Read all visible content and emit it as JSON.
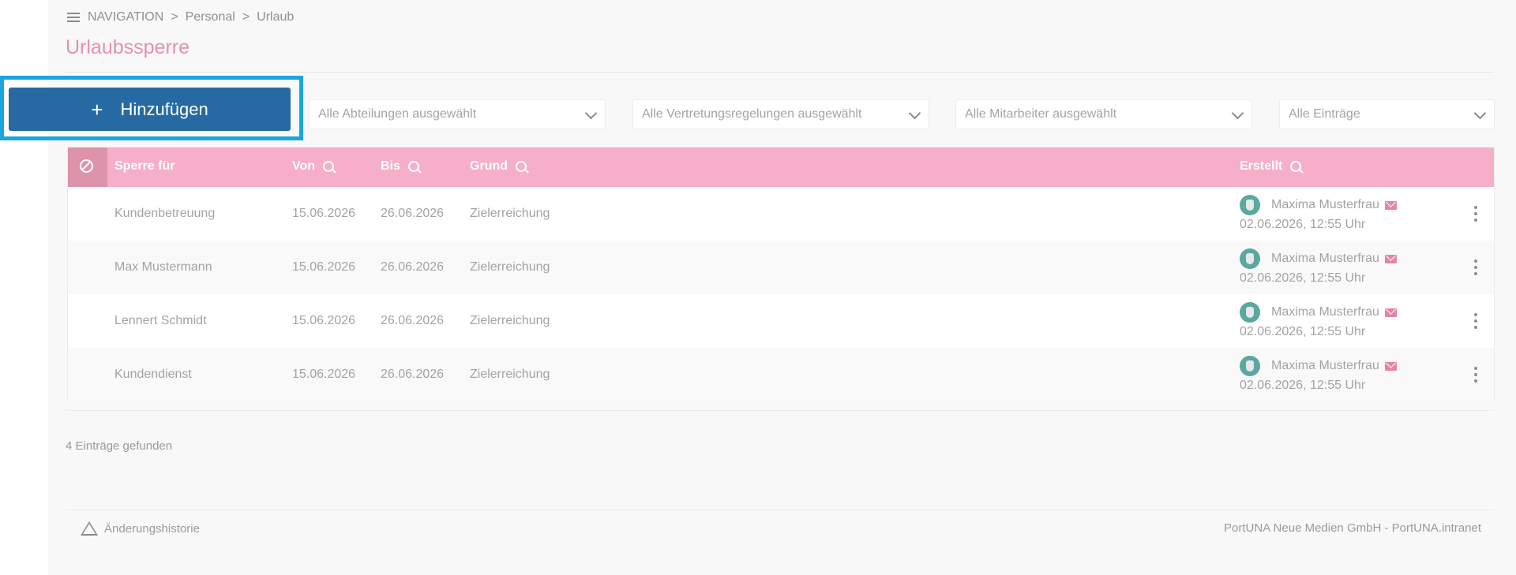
{
  "breadcrumb": {
    "nav": "NAVIGATION",
    "sep": ">",
    "level1": "Personal",
    "level2": "Urlaub"
  },
  "page": {
    "title": "Urlaubssperre"
  },
  "toolbar": {
    "add_plus": "+",
    "add_label": "Hinzufügen"
  },
  "filters": {
    "departments": "Alle Abteilungen ausgewählt",
    "deputies": "Alle Vertretungsregelungen ausgewählt",
    "employees": "Alle Mitarbeiter ausgewählt",
    "entries": "Alle Einträge"
  },
  "table": {
    "headers": {
      "sperre_fuer": "Sperre für",
      "von": "Von",
      "bis": "Bis",
      "grund": "Grund",
      "erstellt": "Erstellt"
    },
    "rows": [
      {
        "sperre_fuer": "Kundenbetreuung",
        "von": "15.06.2026",
        "bis": "26.06.2026",
        "grund": "Zielerreichung",
        "creator": "Maxima Musterfrau",
        "created": "02.06.2026, 12:55 Uhr"
      },
      {
        "sperre_fuer": "Max Mustermann",
        "von": "15.06.2026",
        "bis": "26.06.2026",
        "grund": "Zielerreichung",
        "creator": "Maxima Musterfrau",
        "created": "02.06.2026, 12:55 Uhr"
      },
      {
        "sperre_fuer": "Lennert Schmidt",
        "von": "15.06.2026",
        "bis": "26.06.2026",
        "grund": "Zielerreichung",
        "creator": "Maxima Musterfrau",
        "created": "02.06.2026, 12:55 Uhr"
      },
      {
        "sperre_fuer": "Kundendienst",
        "von": "15.06.2026",
        "bis": "26.06.2026",
        "grund": "Zielerreichung",
        "creator": "Maxima Musterfrau",
        "created": "02.06.2026, 12:55 Uhr"
      }
    ]
  },
  "result_count": "4 Einträge gefunden",
  "footer": {
    "history": "Änderungshistorie",
    "copyright": "PortUNA Neue Medien GmbH - PortUNA.intranet"
  },
  "colors": {
    "accent_pink": "#f7aec8",
    "title_pink": "#e58fb2",
    "button_blue": "#276aa3",
    "highlight_blue": "#1aa6dc"
  },
  "icons": [
    "menu-icon",
    "plus-icon",
    "chevron-down-icon",
    "block-icon",
    "search-icon",
    "avatar",
    "mail-icon",
    "kebab-menu-icon",
    "triangle-icon"
  ]
}
